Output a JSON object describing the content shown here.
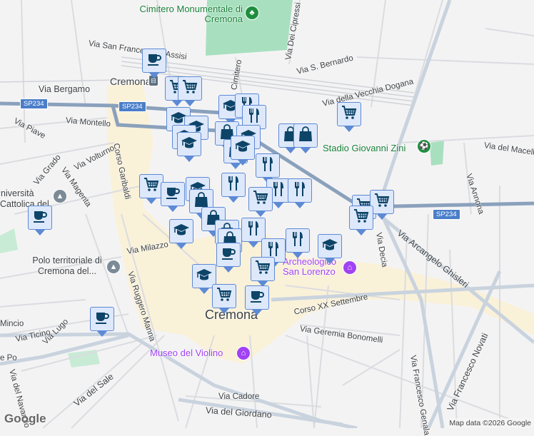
{
  "map": {
    "city_label": "Cremona",
    "station_label": "Cremona",
    "road_shield": "SP234",
    "streets": [
      "Via San Francesco d'Assisi",
      "Via Bergamo",
      "Via Piave",
      "Via Montello",
      "Via Volturno",
      "Corso Garibaldi",
      "Via Grado",
      "Via Magenta",
      "Via Milazzo",
      "Via Ruggero Manna",
      "Via Lugo",
      "Via Ticino",
      "Mincio",
      "e Po",
      "Via del Sale",
      "Via del Navarolo",
      "Via Cadore",
      "Via del Giordano",
      "Via Dei Cipressi",
      "Via S. Bernardo",
      "Via della Vecchia Dogana",
      "Via del Macello",
      "Via Annona",
      "Via Decia",
      "Via Arcangelo Ghisleri",
      "Corso XX Settembre",
      "Via Geremia Bonomelli",
      "Via Francesco Genala",
      "Via Francesco Novati",
      "Cimitero"
    ],
    "pois": {
      "cemetery": "Cimitero Monumentale di Cremona",
      "stadium": "Stadio Giovanni Zini",
      "university": "Università Cattolica del Sacro Cuore",
      "polo": "Polo territoriale di Cremona del...",
      "museum_violin": "Museo del Violino",
      "museum_archeo": "Archeologico San Lorenzo"
    },
    "markers": [
      "coffee",
      "cart",
      "cart",
      "grad",
      "fork",
      "fork",
      "grad",
      "grad",
      "grad",
      "grad",
      "bag",
      "grad",
      "bag",
      "grad",
      "cart",
      "bag",
      "bag",
      "fork",
      "fork",
      "fork",
      "fork",
      "cart",
      "coffee",
      "grad",
      "bag",
      "cart",
      "bag",
      "bag",
      "bag",
      "fork",
      "grad",
      "cart",
      "cart",
      "cart",
      "coffee",
      "coffee",
      "fork",
      "fork",
      "grad",
      "cart",
      "grad",
      "cart",
      "coffee",
      "coffee"
    ],
    "attribution": "Map data ©2026 Google",
    "logo": "Google"
  }
}
